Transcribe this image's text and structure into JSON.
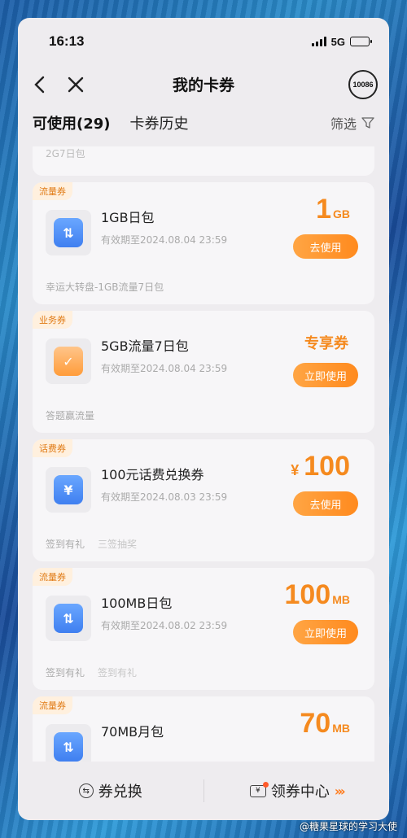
{
  "status": {
    "time": "16:13",
    "network": "5G"
  },
  "nav": {
    "title": "我的卡券",
    "service_label": "10086"
  },
  "tabs": [
    {
      "label": "可使用(29)",
      "active": true
    },
    {
      "label": "卡券历史",
      "active": false
    }
  ],
  "filter_label": "筛选",
  "partial_top_text": "2G7日包",
  "cards": [
    {
      "badge": "流量券",
      "icon": "arrows-updown-icon",
      "title": "1GB日包",
      "expiry": "有效期至2024.08.04 23:59",
      "amount": "1",
      "unit": "GB",
      "action": "去使用",
      "foot": [
        "幸运大转盘-1GB流量7日包"
      ]
    },
    {
      "badge": "业务券",
      "icon": "shopping-bag-icon",
      "title": "5GB流量7日包",
      "expiry": "有效期至2024.08.04 23:59",
      "amount_text": "专享券",
      "action": "立即使用",
      "foot": [
        "答题赢流量"
      ]
    },
    {
      "badge": "话费券",
      "icon": "yuan-icon",
      "title": "100元话费兑换券",
      "expiry": "有效期至2024.08.03 23:59",
      "currency": "¥",
      "amount": "100",
      "action": "去使用",
      "foot": [
        "签到有礼",
        "三签抽奖"
      ]
    },
    {
      "badge": "流量券",
      "icon": "arrows-updown-icon",
      "title": "100MB日包",
      "expiry": "有效期至2024.08.02 23:59",
      "amount": "100",
      "unit": "MB",
      "action": "立即使用",
      "foot": [
        "签到有礼",
        "签到有礼"
      ]
    },
    {
      "badge": "流量券",
      "icon": "arrows-updown-icon",
      "title": "70MB月包",
      "amount": "70",
      "unit": "MB"
    }
  ],
  "bottom": {
    "exchange_label": "券兑换",
    "center_label": "领券中心",
    "center_arrows": "›››"
  },
  "watermark": "@糖果星球的学习大使",
  "colors": {
    "accent": "#f58a1f",
    "icon_blue": "#3f7ff0"
  }
}
